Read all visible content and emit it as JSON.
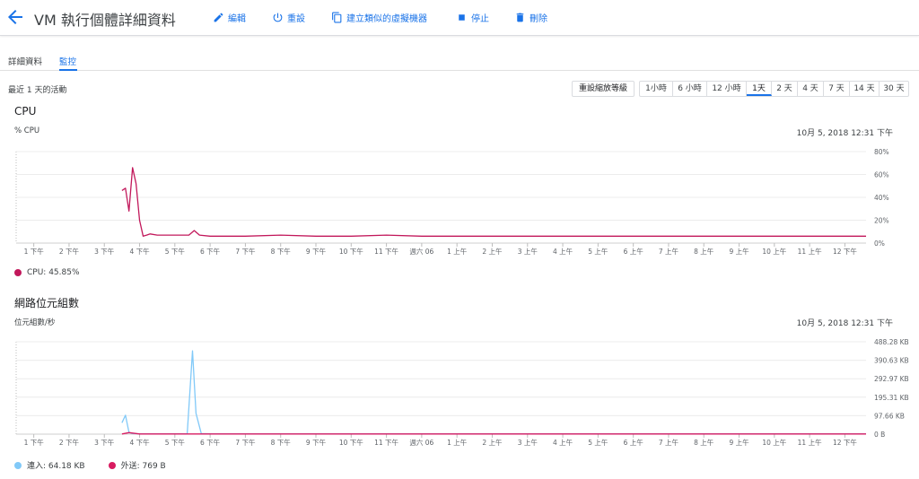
{
  "header": {
    "title": "VM 執行個體詳細資料",
    "actions": [
      {
        "label": "編輯",
        "icon": "pencil-icon"
      },
      {
        "label": "重設",
        "icon": "power-icon"
      },
      {
        "label": "建立類似的虛擬機器",
        "icon": "copy-icon"
      },
      {
        "label": "停止",
        "icon": "stop-icon"
      },
      {
        "label": "刪除",
        "icon": "trash-icon"
      }
    ]
  },
  "tabs": [
    {
      "label": "詳細資料"
    },
    {
      "label": "監控",
      "active": true
    }
  ],
  "toolbar": {
    "range_text": "最近 1 天的活動",
    "reset_zoom_label": "重設縮放等級",
    "ranges": [
      "1小時",
      "6 小時",
      "12 小時",
      "1天",
      "2 天",
      "4 天",
      "7 天",
      "14 天",
      "30 天"
    ],
    "active_range": "1天"
  },
  "colors": {
    "accent": "#1a73e8",
    "cpu": "#c2185b",
    "received": "#81c9f8",
    "sent": "#d81b60"
  },
  "chart_data": [
    {
      "type": "line",
      "title": "CPU",
      "ylabel": "% CPU",
      "timestamp": "10月 5, 2018 12:31 下午",
      "y_ticks": [
        "80%",
        "60%",
        "40%",
        "20%",
        "0%"
      ],
      "ylim": [
        0,
        80
      ],
      "x_ticks": [
        "1 下午",
        "2 下午",
        "3 下午",
        "4 下午",
        "5 下午",
        "6 下午",
        "7 下午",
        "8 下午",
        "9 下午",
        "10 下午",
        "11 下午",
        "週六 06",
        "1 上午",
        "2 上午",
        "3 上午",
        "4 上午",
        "5 上午",
        "6 上午",
        "7 上午",
        "8 上午",
        "9 上午",
        "10 上午",
        "11 上午",
        "12 下午"
      ],
      "x_start_hour": 12.5,
      "x_end_hour": 36.6,
      "series": [
        {
          "name": "CPU",
          "legend_value": "CPU: 45.85%",
          "x": [
            15.5,
            15.6,
            15.7,
            15.8,
            15.9,
            16.0,
            16.1,
            16.2,
            16.3,
            16.5,
            17.0,
            17.4,
            17.55,
            17.7,
            18.0,
            19.0,
            20.0,
            21.0,
            22.0,
            23.0,
            24.0,
            25.0,
            26.0,
            27.0,
            28.0,
            29.0,
            30.0,
            31.0,
            32.0,
            33.0,
            34.0,
            35.0,
            36.0,
            36.6
          ],
          "values": [
            46,
            48,
            28,
            66,
            52,
            20,
            6,
            7,
            8,
            7,
            7,
            7,
            11,
            7,
            6,
            6,
            7,
            6,
            6,
            7,
            6,
            6,
            6,
            6,
            6,
            6,
            6,
            6,
            6,
            6,
            6,
            6,
            6,
            6
          ]
        }
      ]
    },
    {
      "type": "line",
      "title": "網路位元組數",
      "ylabel": "位元組數/秒",
      "timestamp": "10月 5, 2018 12:31 下午",
      "y_ticks": [
        "488.28 KB",
        "390.63 KB",
        "292.97 KB",
        "195.31 KB",
        "97.66 KB",
        "0 B"
      ],
      "ylim": [
        0,
        488.28
      ],
      "x_ticks": [
        "1 下午",
        "2 下午",
        "3 下午",
        "4 下午",
        "5 下午",
        "6 下午",
        "7 下午",
        "8 下午",
        "9 下午",
        "10 下午",
        "11 下午",
        "週六 06",
        "1 上午",
        "2 上午",
        "3 上午",
        "4 上午",
        "5 上午",
        "6 上午",
        "7 上午",
        "8 上午",
        "9 上午",
        "10 上午",
        "11 上午",
        "12 下午"
      ],
      "x_start_hour": 12.5,
      "x_end_hour": 36.6,
      "series": [
        {
          "name": "連入",
          "legend_value": "連入: 64.18 KB",
          "x": [
            15.5,
            15.6,
            15.7,
            15.8,
            16.0,
            17.0,
            17.35,
            17.5,
            17.6,
            17.75,
            18.0,
            20.0,
            24.0,
            30.0,
            36.6
          ],
          "values": [
            60,
            100,
            10,
            3,
            2,
            2,
            2,
            440,
            110,
            3,
            2,
            2,
            2,
            2,
            2
          ]
        },
        {
          "name": "外送",
          "legend_value": "外送: 769 B",
          "x": [
            15.5,
            15.7,
            16.0,
            17.0,
            18.0,
            20.0,
            24.0,
            30.0,
            36.6
          ],
          "values": [
            1,
            8,
            1,
            1,
            1,
            1,
            1,
            1,
            1
          ]
        }
      ]
    }
  ]
}
